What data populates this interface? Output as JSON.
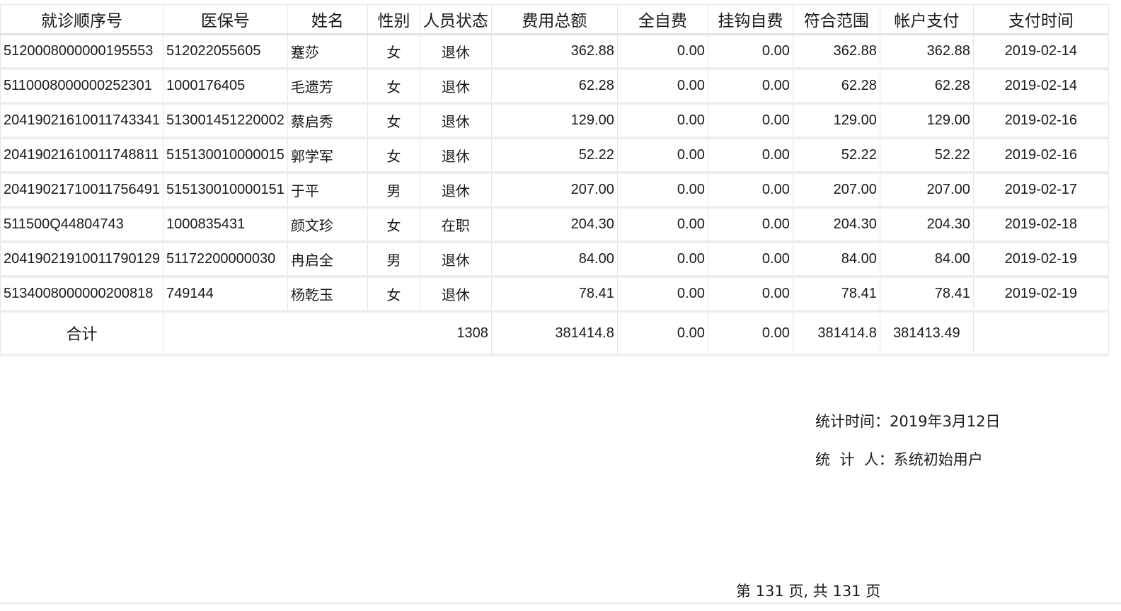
{
  "table": {
    "headers": [
      "就诊顺序号",
      "医保号",
      "姓名",
      "性别",
      "人员状态",
      "费用总额",
      "全自费",
      "挂钩自费",
      "符合范围",
      "帐户支付",
      "支付时间"
    ],
    "rows": [
      [
        "5120008000000195553",
        "512022055605",
        "蹇莎",
        "女",
        "退休",
        "362.88",
        "0.00",
        "0.00",
        "362.88",
        "362.88",
        "2019-02-14"
      ],
      [
        "5110008000000252301",
        "1000176405",
        "毛遗芳",
        "女",
        "退休",
        "62.28",
        "0.00",
        "0.00",
        "62.28",
        "62.28",
        "2019-02-14"
      ],
      [
        "20419021610011743341",
        "513001451220002",
        "蔡启秀",
        "女",
        "退休",
        "129.00",
        "0.00",
        "0.00",
        "129.00",
        "129.00",
        "2019-02-16"
      ],
      [
        "20419021610011748811",
        "515130010000015",
        "郭学军",
        "女",
        "退休",
        "52.22",
        "0.00",
        "0.00",
        "52.22",
        "52.22",
        "2019-02-16"
      ],
      [
        "20419021710011756491",
        "515130010000151",
        "于平",
        "男",
        "退休",
        "207.00",
        "0.00",
        "0.00",
        "207.00",
        "207.00",
        "2019-02-17"
      ],
      [
        "511500Q44804743",
        "1000835431",
        "颜文珍",
        "女",
        "在职",
        "204.30",
        "0.00",
        "0.00",
        "204.30",
        "204.30",
        "2019-02-18"
      ],
      [
        "20419021910011790129",
        "51172200000030",
        "冉启全",
        "男",
        "退休",
        "84.00",
        "0.00",
        "0.00",
        "84.00",
        "84.00",
        "2019-02-19"
      ],
      [
        "5134008000000200818",
        "749144",
        "杨乾玉",
        "女",
        "退休",
        "78.41",
        "0.00",
        "0.00",
        "78.41",
        "78.41",
        "2019-02-19"
      ]
    ],
    "total": {
      "label": "合计",
      "count": "1308",
      "total_amount": "381414.8",
      "self_pay": "0.00",
      "hook_self_pay": "0.00",
      "in_scope": "381414.8",
      "account_pay": "381413.49",
      "pay_time": ""
    }
  },
  "footer": {
    "stat_time": "统计时间：2019年3月12日",
    "stat_person": "统  计  人：系统初始用户",
    "pager": "第 131 页, 共 131 页"
  }
}
